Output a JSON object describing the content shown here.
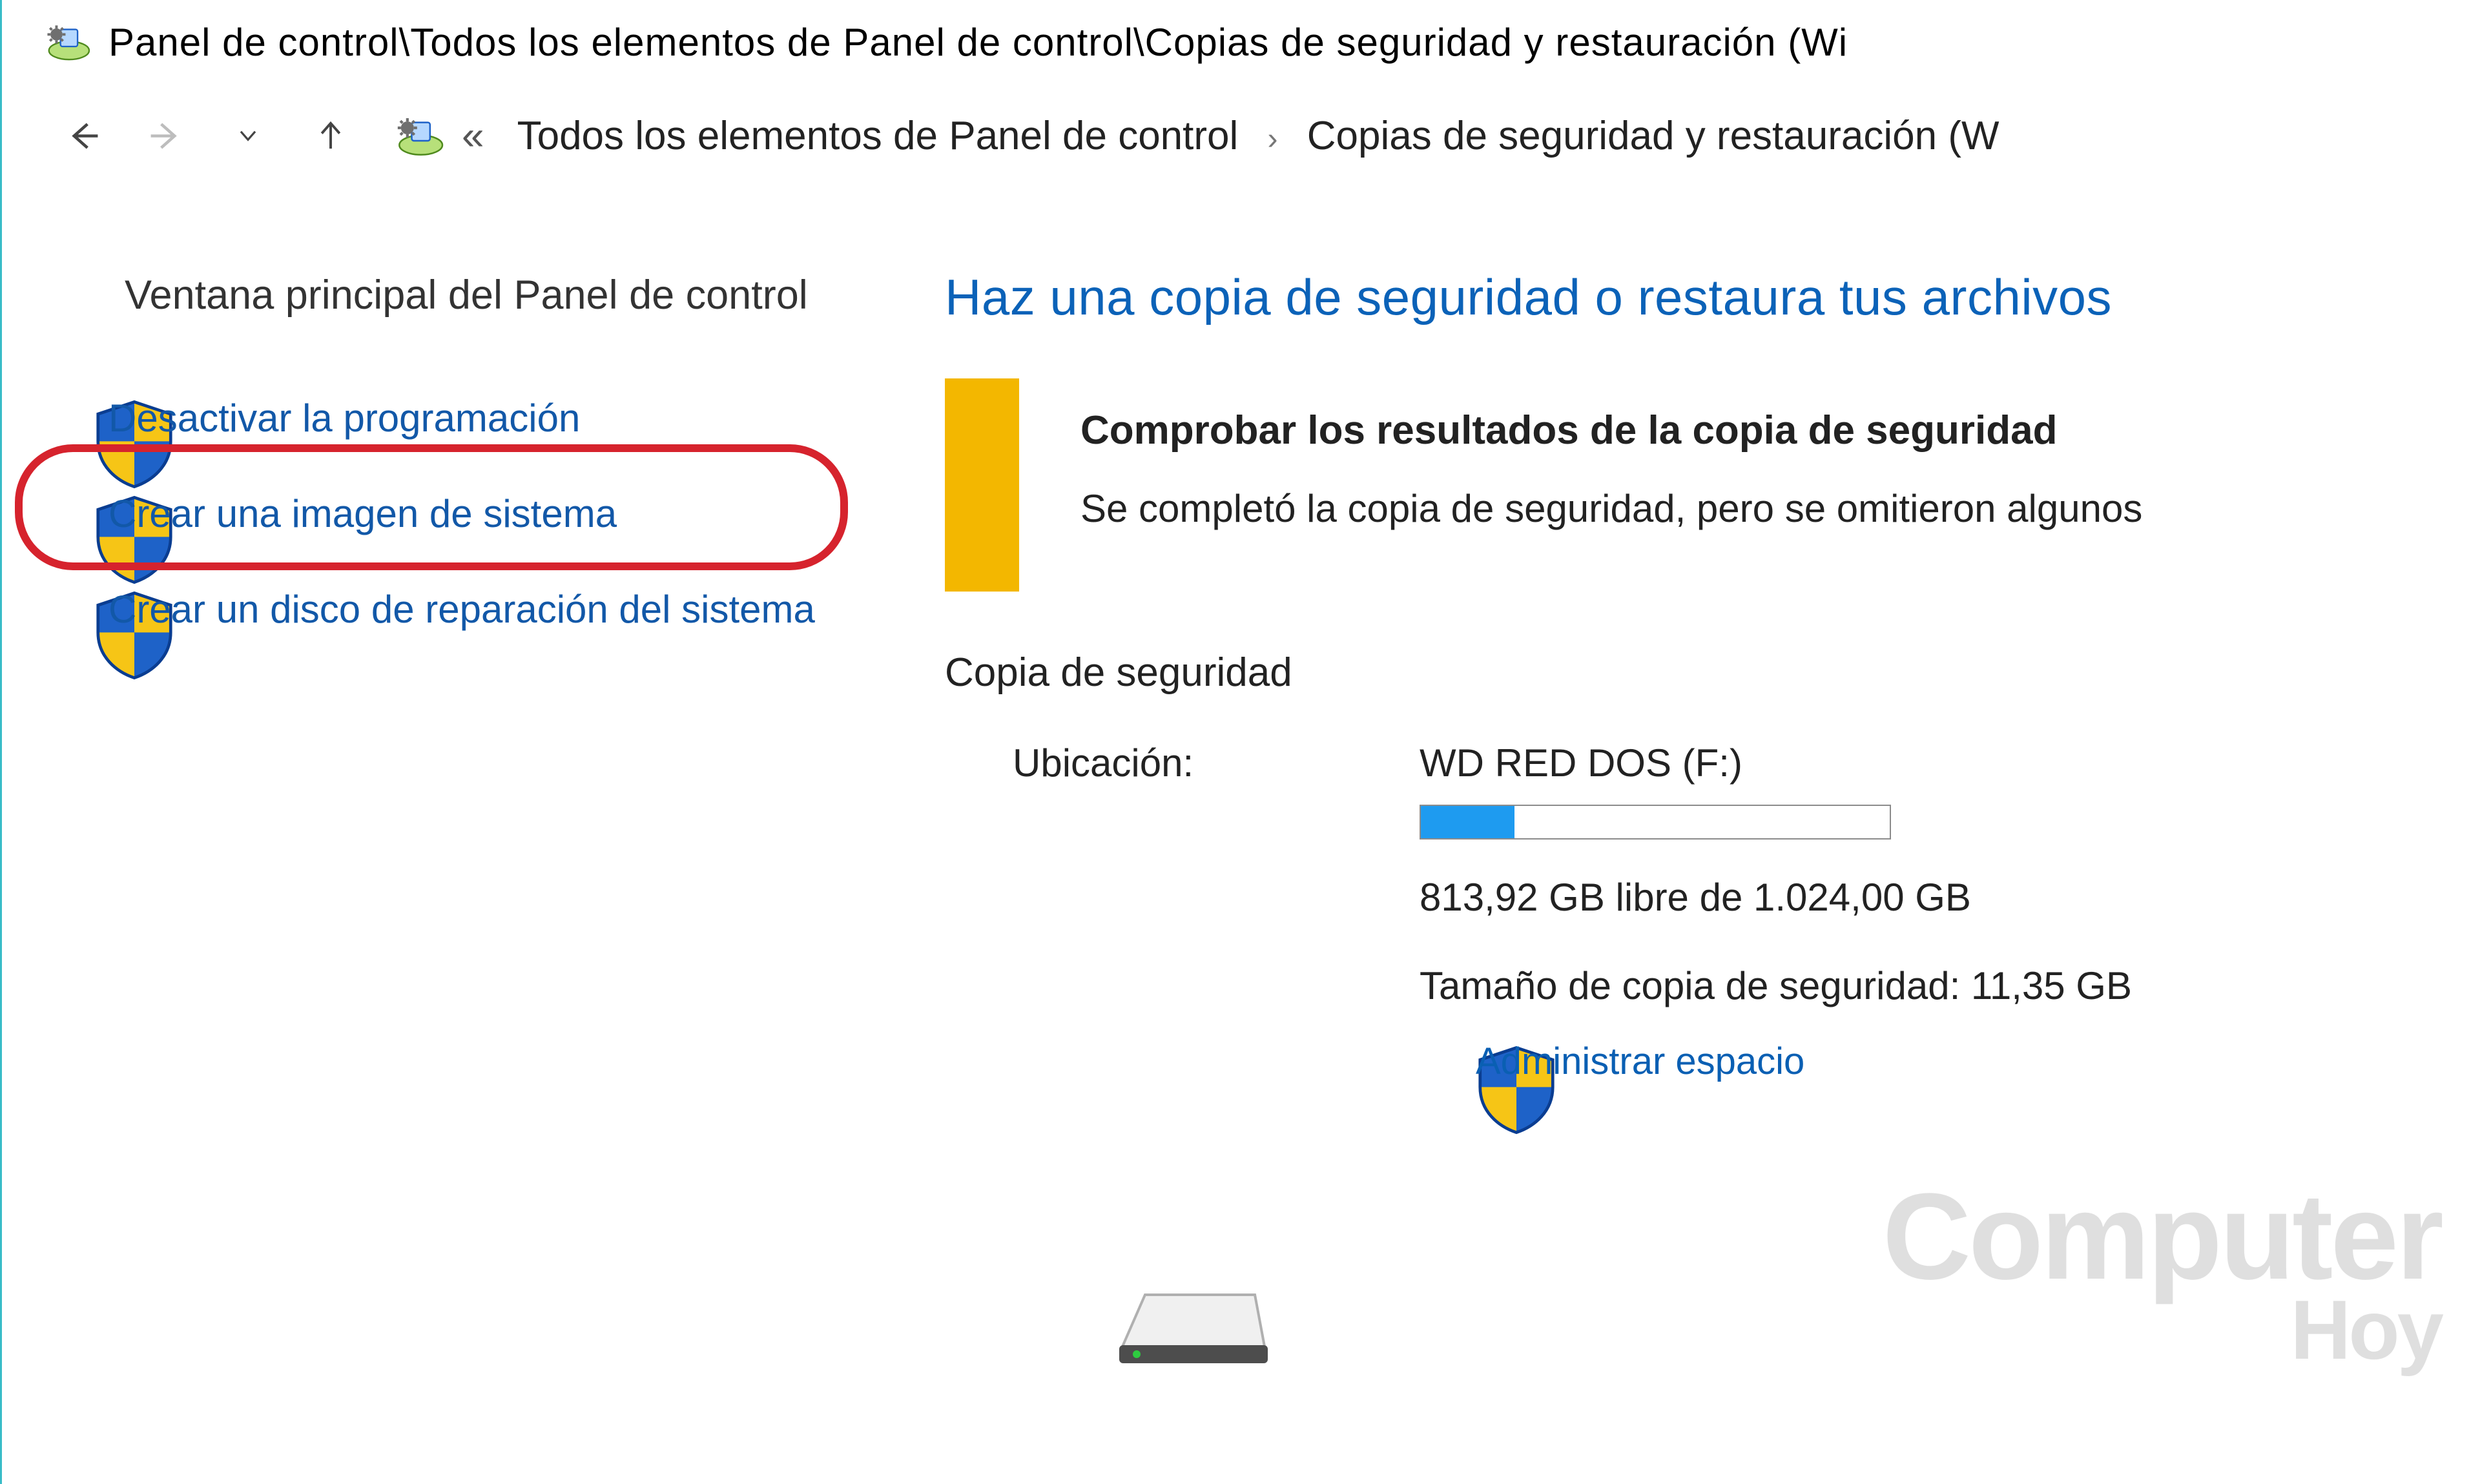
{
  "window": {
    "title_path": "Panel de control\\Todos los elementos de Panel de control\\Copias de seguridad y restauración (Wi"
  },
  "address_bar": {
    "segment1": "Todos los elementos de Panel de control",
    "segment2": "Copias de seguridad y restauración (W",
    "prefix_glyph": "«",
    "separator_glyph": "›"
  },
  "sidebar": {
    "heading": "Ventana principal del Panel de control",
    "tasks": [
      {
        "label": "Desactivar la programación"
      },
      {
        "label": "Crear una imagen de sistema"
      },
      {
        "label": "Crear un disco de reparación del sistema"
      }
    ]
  },
  "main": {
    "heading": "Haz una copia de seguridad o restaura tus archivos",
    "notice": {
      "title": "Comprobar los resultados de la copia de seguridad",
      "message": "Se completó la copia de seguridad, pero se omitieron algunos"
    },
    "backup": {
      "section_heading": "Copia de seguridad",
      "location_label": "Ubicación:",
      "location_name": "WD RED DOS (F:)",
      "free_space": "813,92 GB libre de 1.024,00 GB",
      "progress_percent": 20,
      "backup_size_label": "Tamaño de copia de seguridad:",
      "backup_size_value": "11,35 GB",
      "manage_space_label": "Administrar espacio"
    }
  },
  "watermark": {
    "line1": "Computer",
    "line2": "Hoy"
  },
  "icons": {
    "control_panel": "control-panel-icon",
    "shield": "uac-shield-icon",
    "disk": "external-disk-icon"
  }
}
